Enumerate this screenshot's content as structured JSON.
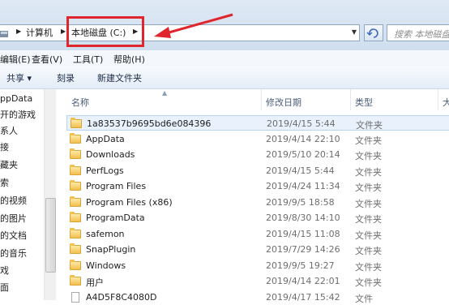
{
  "address_bar": {
    "crumbs": [
      "计算机",
      "本地磁盘 (C:)"
    ],
    "search_placeholder": "搜索 本地磁盘"
  },
  "menu": [
    "编辑(E)",
    "查看(V)",
    "工具(T)",
    "帮助(H)"
  ],
  "toolbar": [
    "共享 ▾",
    "刻录",
    "新建文件夹"
  ],
  "nav_items": [
    "ppData",
    "开的游戏",
    "系人",
    "接",
    "藏夹",
    "索",
    "的视频",
    "的图片",
    "的文档",
    "的音乐",
    "戏",
    "面"
  ],
  "columns": {
    "name": "名称",
    "date": "修改日期",
    "type": "类型",
    "size": "大"
  },
  "files": [
    {
      "name": "1a83537b9695bd6e084396",
      "date": "2019/4/15 5:44",
      "type": "文件夹",
      "kind": "folder",
      "selected": true
    },
    {
      "name": "AppData",
      "date": "2019/4/14 22:10",
      "type": "文件夹",
      "kind": "folder"
    },
    {
      "name": "Downloads",
      "date": "2019/5/10 20:14",
      "type": "文件夹",
      "kind": "folder"
    },
    {
      "name": "PerfLogs",
      "date": "2019/4/15 5:44",
      "type": "文件夹",
      "kind": "folder"
    },
    {
      "name": "Program Files",
      "date": "2019/4/24 11:34",
      "type": "文件夹",
      "kind": "folder"
    },
    {
      "name": "Program Files (x86)",
      "date": "2019/9/5 18:58",
      "type": "文件夹",
      "kind": "folder"
    },
    {
      "name": "ProgramData",
      "date": "2019/8/30 14:10",
      "type": "文件夹",
      "kind": "folder"
    },
    {
      "name": "safemon",
      "date": "2019/4/15 11:08",
      "type": "文件夹",
      "kind": "folder"
    },
    {
      "name": "SnapPlugin",
      "date": "2019/7/29 14:26",
      "type": "文件夹",
      "kind": "folder"
    },
    {
      "name": "Windows",
      "date": "2019/9/5 19:27",
      "type": "文件夹",
      "kind": "folder"
    },
    {
      "name": "用户",
      "date": "2019/4/14 22:01",
      "type": "文件夹",
      "kind": "folder"
    },
    {
      "name": "A4D5F8C4080D",
      "date": "2019/4/17 15:42",
      "type": "文件",
      "kind": "file"
    }
  ],
  "colors": {
    "annotation_red": "#e0262d",
    "selection": "#e8f1fc"
  }
}
